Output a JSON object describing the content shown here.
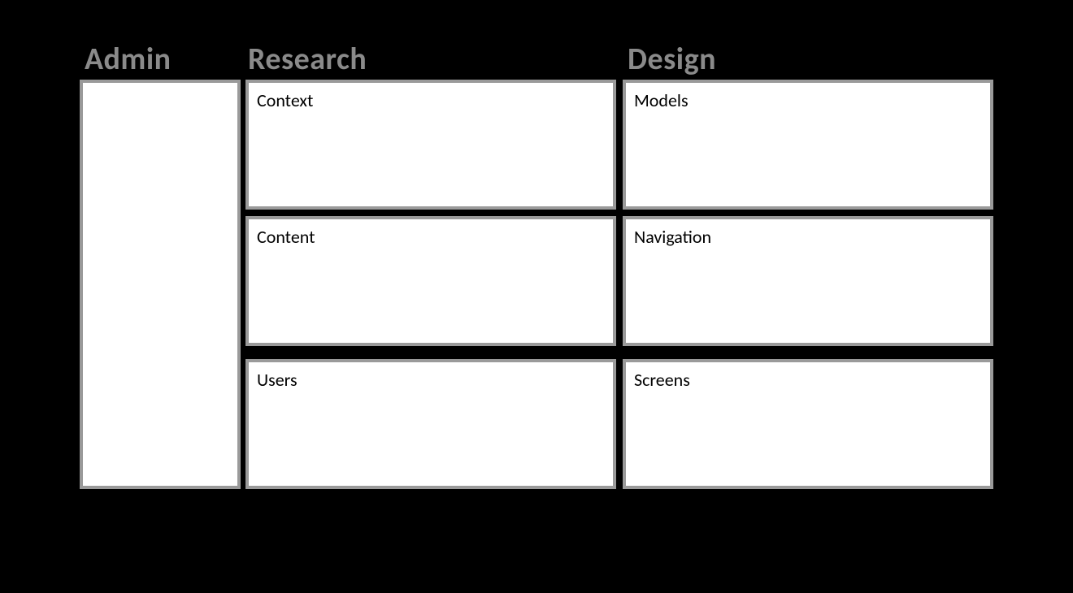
{
  "columns": {
    "admin": {
      "header": "Admin"
    },
    "research": {
      "header": "Research",
      "cells": [
        "Context",
        "Content",
        "Users"
      ]
    },
    "design": {
      "header": "Design",
      "cells": [
        "Models",
        "Navigation",
        "Screens"
      ]
    }
  }
}
